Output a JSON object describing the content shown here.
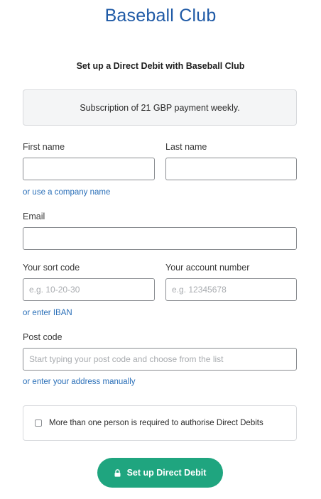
{
  "header": {
    "brand": "Baseball Club",
    "subtitle": "Set up a Direct Debit with Baseball Club"
  },
  "summary": {
    "text": "Subscription of 21 GBP payment weekly."
  },
  "form": {
    "first_name": {
      "label": "First name",
      "value": ""
    },
    "last_name": {
      "label": "Last name",
      "value": ""
    },
    "company_link": "or use a company name",
    "email": {
      "label": "Email",
      "value": ""
    },
    "sort_code": {
      "label": "Your sort code",
      "placeholder": "e.g. 10-20-30",
      "value": ""
    },
    "account_number": {
      "label": "Your account number",
      "placeholder": "e.g. 12345678",
      "value": ""
    },
    "iban_link": "or enter IBAN",
    "post_code": {
      "label": "Post code",
      "placeholder": "Start typing your post code and choose from the list",
      "value": ""
    },
    "address_link": "or enter your address manually",
    "consent": {
      "text": "More than one person is required to authorise Direct Debits",
      "checked": false
    },
    "submit_label": "Set up Direct Debit"
  },
  "colors": {
    "brand": "#1f5aa6",
    "link": "#2a6fb8",
    "primary_button": "#1fa57f",
    "summary_bg": "#f4f5f6"
  },
  "icons": {
    "submit": "lock-icon"
  }
}
